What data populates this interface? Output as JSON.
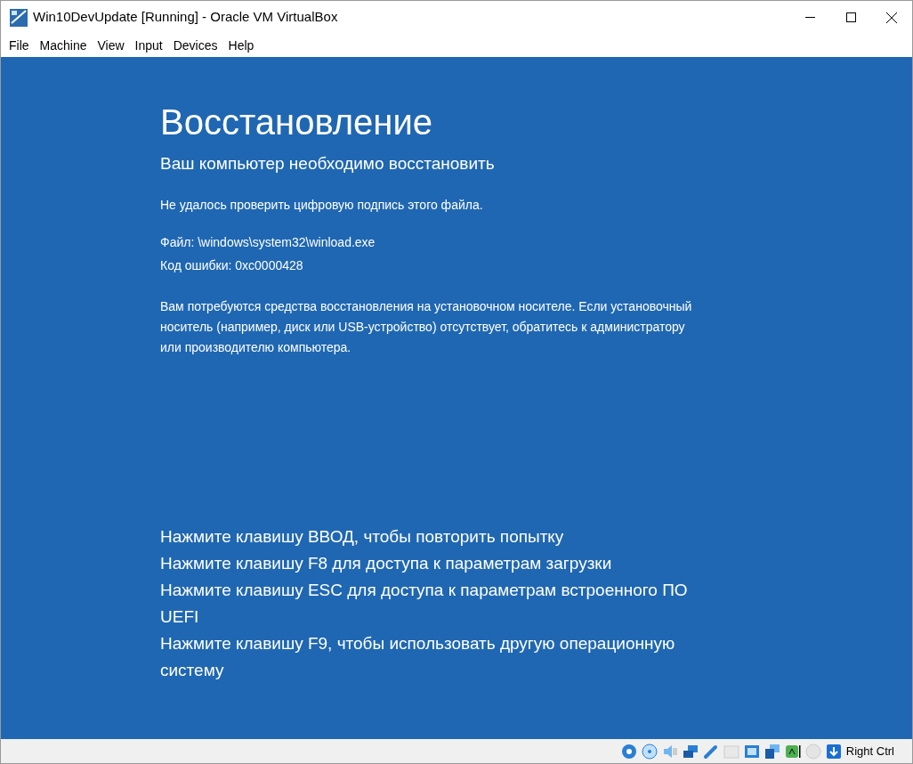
{
  "window": {
    "title": "Win10DevUpdate [Running] - Oracle VM VirtualBox"
  },
  "menu": [
    "File",
    "Machine",
    "View",
    "Input",
    "Devices",
    "Help"
  ],
  "screen": {
    "heading": "Восстановление",
    "subheading": "Ваш компьютер необходимо восстановить",
    "message": "Не удалось проверить цифровую подпись этого файла.",
    "details": [
      "Файл: \\windows\\system32\\winload.exe",
      "Код ошибки: 0xc0000428"
    ],
    "advice": "Вам потребуются средства восстановления на установочном носителе. Если установочный носитель (например, диск или USB-устройство) отсутствует, обратитесь к администратору или производителю компьютера.",
    "options": [
      "Нажмите клавишу ВВОД, чтобы повторить попытку",
      "Нажмите клавишу F8 для доступа к параметрам загрузки",
      "Нажмите клавишу ESC для доступа к параметрам встроенного ПО UEFI",
      "Нажмите клавишу F9, чтобы использовать другую операционную систему"
    ]
  },
  "status_bar": {
    "host_key": "Right Ctrl"
  }
}
